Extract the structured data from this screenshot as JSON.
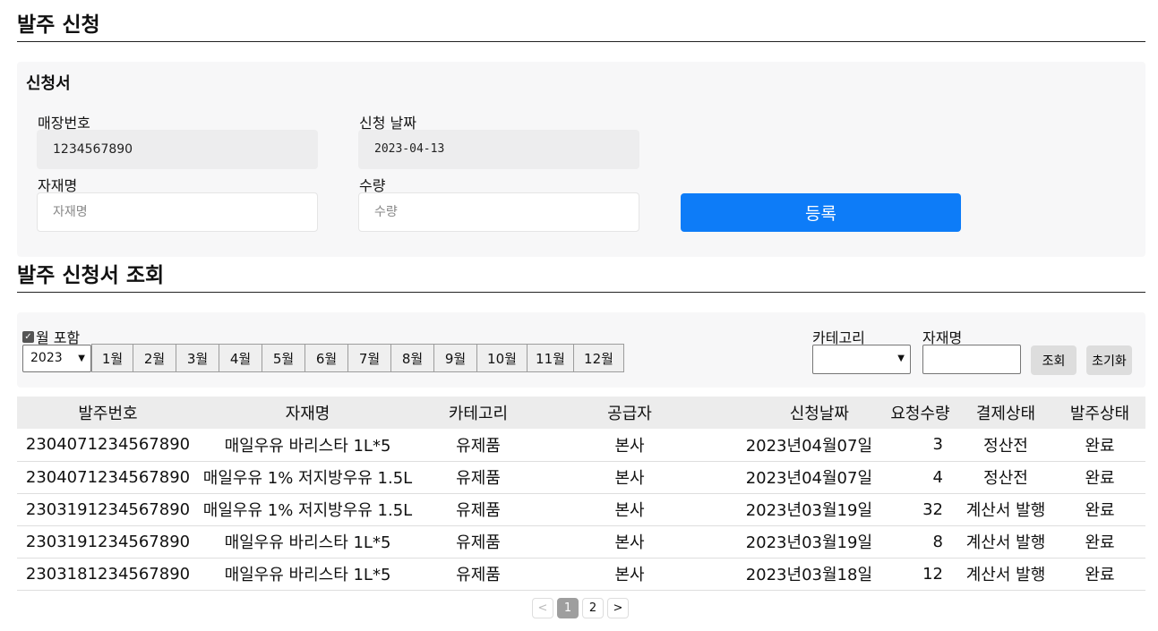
{
  "order_form": {
    "title": "발주 신청",
    "subtitle": "신청서",
    "store_no_label": "매장번호",
    "store_no_value": "1234567890",
    "date_label": "신청 날짜",
    "date_value": "2023-04-13",
    "item_label": "자재명",
    "item_placeholder": "자재명",
    "qty_label": "수량",
    "qty_placeholder": "수량",
    "submit_label": "등록"
  },
  "lookup": {
    "title": "발주 신청서 조회",
    "include_month_label": "월 포함",
    "year_value": "2023",
    "months": [
      "1월",
      "2월",
      "3월",
      "4월",
      "5월",
      "6월",
      "7월",
      "8월",
      "9월",
      "10월",
      "11월",
      "12월"
    ],
    "category_label": "카테고리",
    "item_label": "자재명",
    "search_label": "조회",
    "reset_label": "초기화"
  },
  "table": {
    "headers": [
      "발주번호",
      "자재명",
      "카테고리",
      "공급자",
      "신청날짜",
      "요청수량",
      "결제상태",
      "발주상태"
    ],
    "rows": [
      [
        "2304071234567890",
        "매일우유 바리스타 1L*5",
        "유제품",
        "본사",
        "2023년04월07일",
        "3",
        "정산전",
        "완료"
      ],
      [
        "2304071234567890",
        "매일우유 1% 저지방우유 1.5L",
        "유제품",
        "본사",
        "2023년04월07일",
        "4",
        "정산전",
        "완료"
      ],
      [
        "2303191234567890",
        "매일우유 1% 저지방우유 1.5L",
        "유제품",
        "본사",
        "2023년03월19일",
        "32",
        "계산서 발행",
        "완료"
      ],
      [
        "2303191234567890",
        "매일우유 바리스타 1L*5",
        "유제품",
        "본사",
        "2023년03월19일",
        "8",
        "계산서 발행",
        "완료"
      ],
      [
        "2303181234567890",
        "매일우유 바리스타 1L*5",
        "유제품",
        "본사",
        "2023년03월18일",
        "12",
        "계산서 발행",
        "완료"
      ]
    ]
  },
  "pagination": {
    "prev": "<",
    "pages": [
      "1",
      "2"
    ],
    "next": ">"
  },
  "colors": {
    "primary": "#0d7cf8",
    "panel_bg": "#f7f7f8",
    "header_bg": "#ececec"
  }
}
